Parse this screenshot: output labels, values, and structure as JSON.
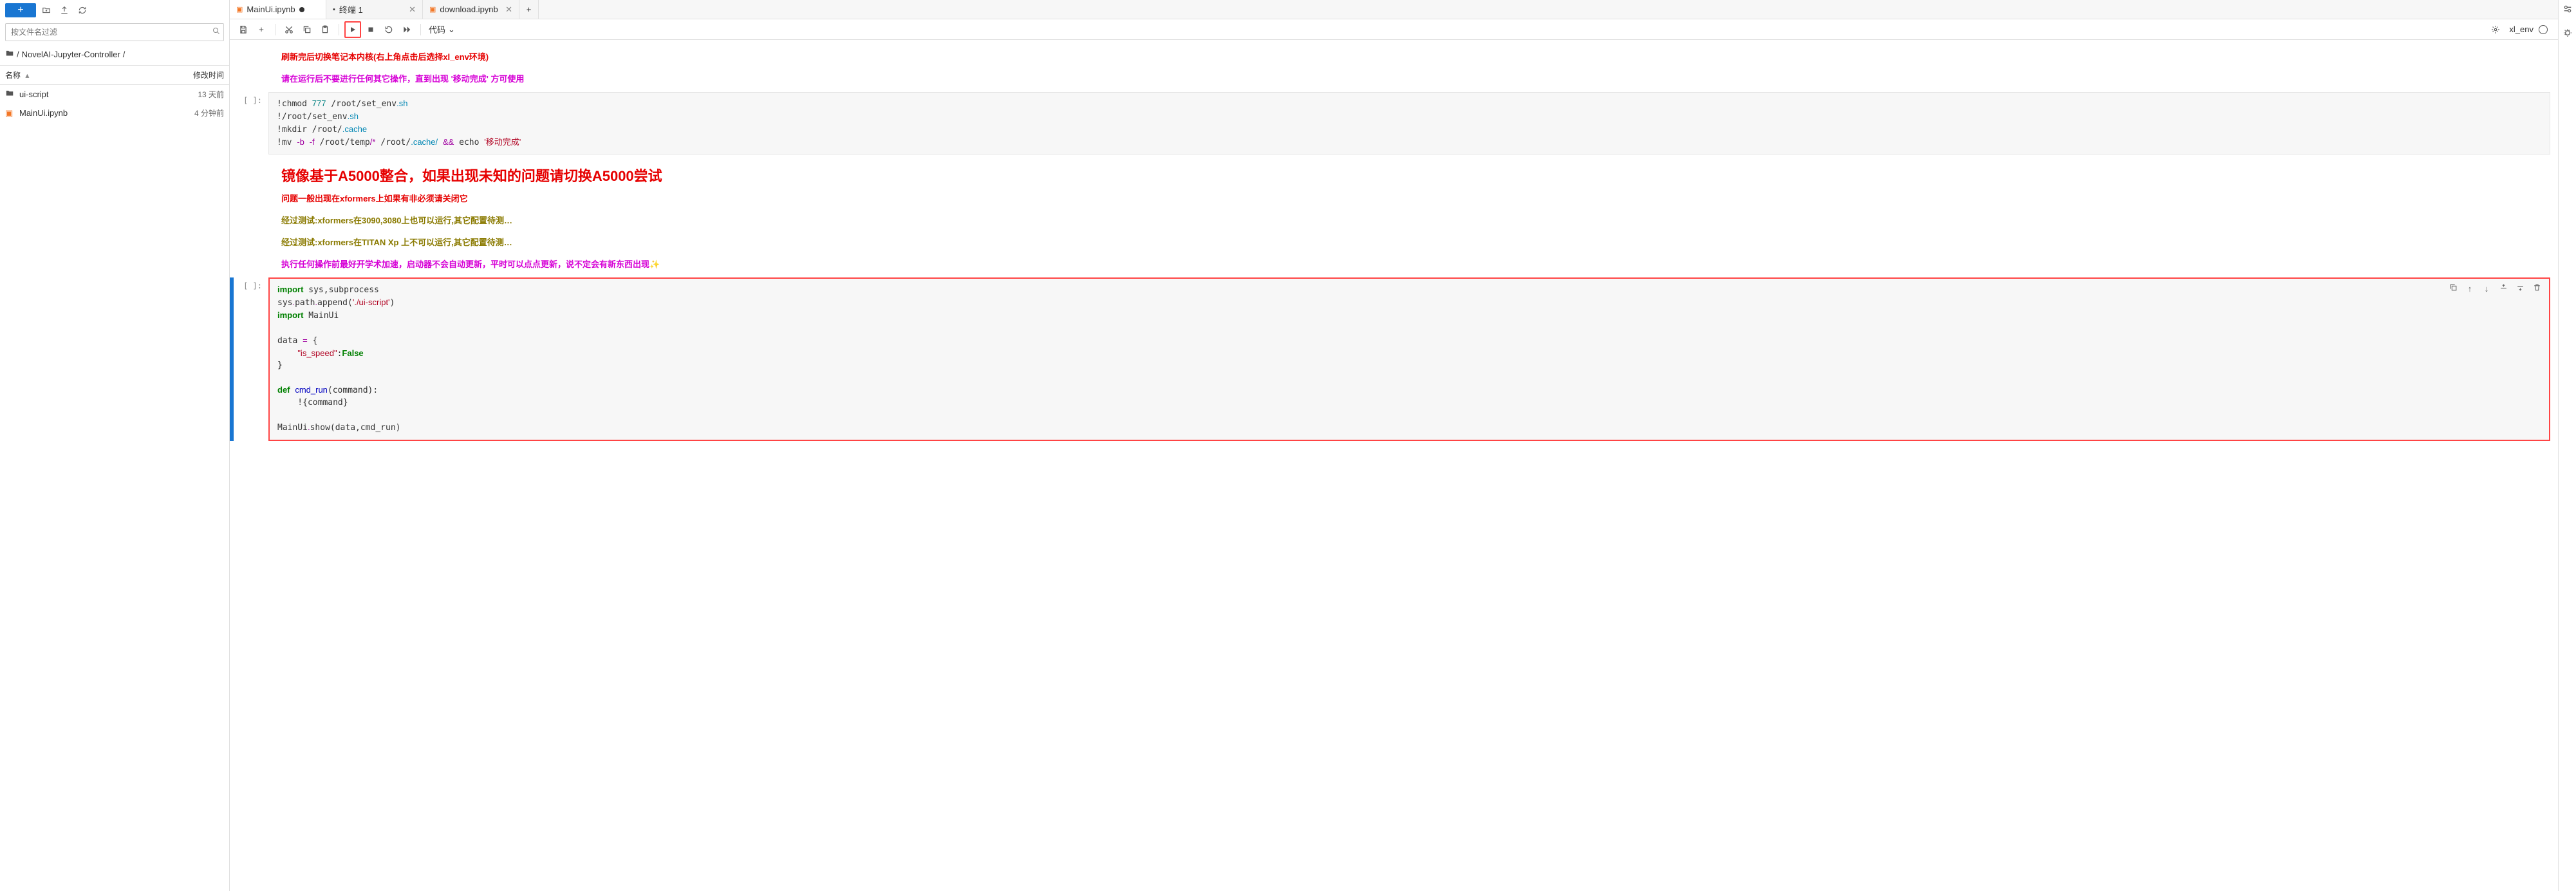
{
  "sidebar": {
    "filter_placeholder": "按文件名过滤",
    "breadcrumb": [
      "/",
      "NovelAI-Jupyter-Controller",
      "/"
    ],
    "columns": {
      "name": "名称",
      "modified": "修改时间"
    },
    "files": [
      {
        "icon": "folder",
        "name": "ui-script",
        "time": "13 天前"
      },
      {
        "icon": "notebook",
        "name": "MainUi.ipynb",
        "time": "4 分钟前"
      }
    ]
  },
  "tabs": [
    {
      "icon": "notebook",
      "label": "MainUi.ipynb",
      "dirty": true,
      "active": true
    },
    {
      "icon": "terminal",
      "label": "终端 1",
      "closable": true
    },
    {
      "icon": "notebook",
      "label": "download.ipynb",
      "closable": true
    }
  ],
  "toolbar": {
    "cell_type": "代码"
  },
  "kernel": {
    "name": "xl_env"
  },
  "markdown": {
    "line1": "刷新完后切换笔记本内核(右上角点击后选择xl_env环境)",
    "line2": "请在运行后不要进行任何其它操作，直到出现 '移动完成' 方可使用",
    "heading": "镜像基于A5000整合，如果出现未知的问题请切换A5000尝试",
    "line3": "问题一般出现在xformers上如果有非必须请关闭它",
    "line4": "经过测试:xformers在3090,3080上也可以运行,其它配置待测…",
    "line5": "经过测试:xformers在TITAN Xp 上不可以运行,其它配置待测…",
    "line6": "执行任何操作前最好开学术加速，启动器不会自动更新，平时可以点点更新，说不定会有新东西出现"
  },
  "cells": [
    {
      "prompt": "[ ]:",
      "code_html": "!chmod <span class='s-num'>777</span> /root/set_env<span class='s-ext'>.sh</span>\n!/root/set_env<span class='s-ext'>.sh</span>\n!mkdir /root/<span class='s-ext'>.cache</span>\n!mv <span class='s-op'>-b</span> <span class='s-op'>-f</span> /root/temp<span class='s-op'>/*</span> /root/<span class='s-ext'>.cache/</span> <span class='s-op'>&amp;&amp;</span> echo <span class='s-str'>'移动完成'</span>"
    },
    {
      "prompt": "[ ]:",
      "active": true,
      "code_html": "<span class='s-kw'>import</span> sys,subprocess\nsys<span class='s-op'>.</span>path<span class='s-op'>.</span>append(<span class='s-str'>'./ui-script'</span>)\n<span class='s-kw'>import</span> MainUi\n\ndata <span class='s-op'>=</span> {\n    <span class='s-str'>\"is_speed\"</span>:<span class='s-bool'>False</span>\n}\n\n<span class='s-kw'>def</span> <span class='s-fn'>cmd_run</span>(command):\n    !{command}\n\nMainUi<span class='s-op'>.</span>show(data,cmd_run)"
    }
  ]
}
